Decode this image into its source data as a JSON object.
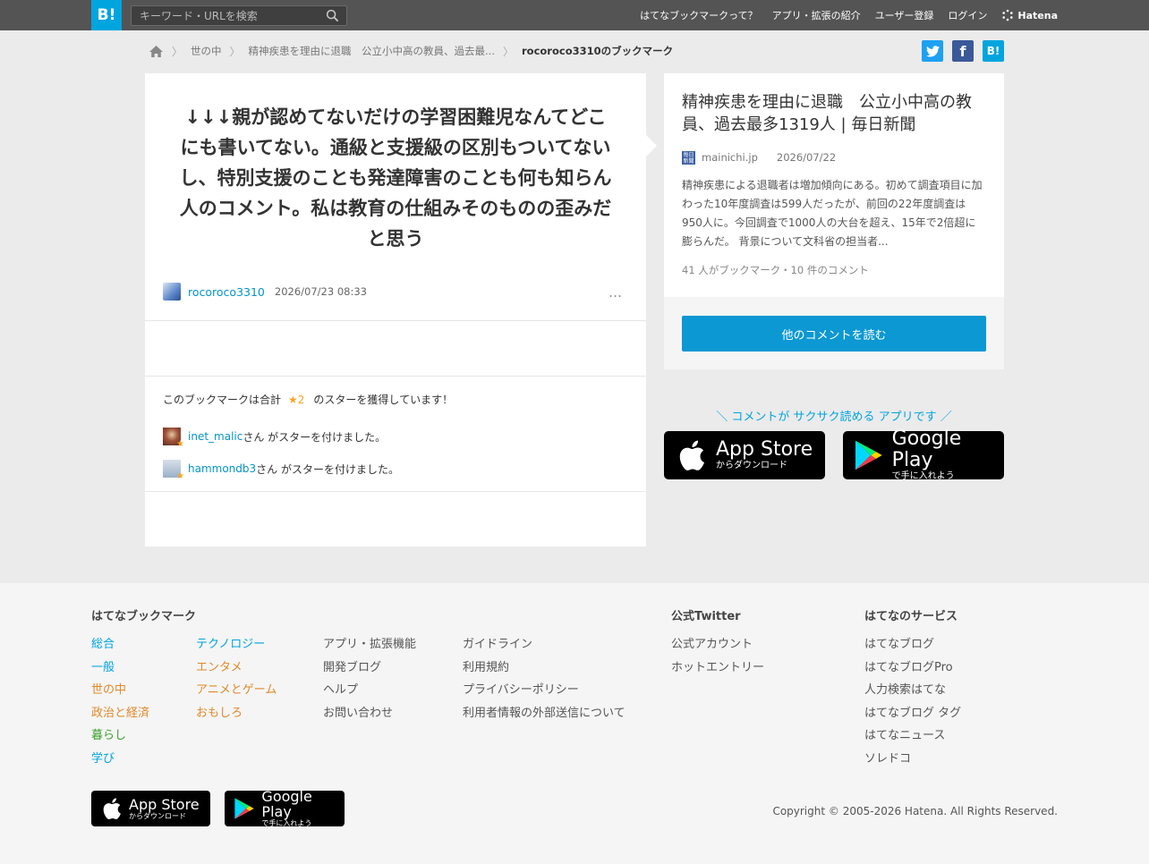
{
  "header": {
    "logo": "B!",
    "search_placeholder": "キーワード・URLを検索",
    "nav": [
      "はてなブックマークって？",
      "アプリ・拡張の紹介",
      "ユーザー登録",
      "ログイン"
    ],
    "brand": "Hatena"
  },
  "breadcrumb": {
    "items": [
      "世の中",
      "精神疾患を理由に退職　公立小中高の教員、過去最...",
      "rocoroco3310のブックマーク"
    ]
  },
  "share": {
    "hatena": "B!"
  },
  "bookmark": {
    "comment": "↓↓↓親が認めてないだけの学習困難児なんてどこにも書いてない。通級と支援級の区別もついてないし、特別支援のことも発達障害のことも何も知らん人のコメント。私は教育の仕組みそのものの歪みだと思う",
    "user": "rocoroco3310",
    "datetime": "2026/07/23 08:33",
    "more": "…"
  },
  "stars": {
    "summary_prefix": "このブックマークは合計",
    "count": "★2",
    "summary_suffix": "のスターを獲得しています！",
    "star_icon": "★",
    "givers": [
      {
        "user": "inet_malic",
        "text": "さん がスターを付けました。"
      },
      {
        "user": "hammondb3",
        "text": "さん がスターを付けました。"
      }
    ]
  },
  "entry": {
    "title": "精神疾患を理由に退職　公立小中高の教員、過去最多1319人 | 毎日新聞",
    "favicon_text": "毎日新聞",
    "domain": "mainichi.jp",
    "date": "2026/07/22",
    "summary": "精神疾患による退職者は増加傾向にある。初めて調査項目に加わった10年度調査は599人だったが、前回の22年度調査は950人に。今回調査で1000人の大台を超え、15年で2倍超に膨らんだ。 背景について文科省の担当者...",
    "stats": "41 人がブックマーク・10 件のコメント",
    "read_more": "他のコメントを読む"
  },
  "app_promo": {
    "text": "＼ コメントが サクサク読める アプリです ／",
    "app_store_main": "App Store",
    "app_store_sub": "からダウンロード",
    "google_play_main": "Google Play",
    "google_play_sub": "で手に入れよう"
  },
  "footer": {
    "heading_bookmark": "はてなブックマーク",
    "heading_twitter": "公式Twitter",
    "heading_services": "はてなのサービス",
    "col1": [
      "総合",
      "一般",
      "世の中",
      "政治と経済",
      "暮らし",
      "学び"
    ],
    "col2": [
      "テクノロジー",
      "エンタメ",
      "アニメとゲーム",
      "おもしろ"
    ],
    "col3": [
      "アプリ・拡張機能",
      "開発ブログ",
      "ヘルプ",
      "お問い合わせ"
    ],
    "col4": [
      "ガイドライン",
      "利用規約",
      "プライバシーポリシー",
      "利用者情報の外部送信について"
    ],
    "twitter": [
      "公式アカウント",
      "ホットエントリー"
    ],
    "services": [
      "はてなブログ",
      "はてなブログPro",
      "人力検索はてな",
      "はてなブログ タグ",
      "はてなニュース",
      "ソレドコ"
    ],
    "copyright": "Copyright © 2005-2026 Hatena. All Rights Reserved."
  },
  "colors": {
    "brand": "#00a4de",
    "topbar": "#545454",
    "link": "#0495c8",
    "star": "#f5a623",
    "button": "#0c98d2"
  }
}
